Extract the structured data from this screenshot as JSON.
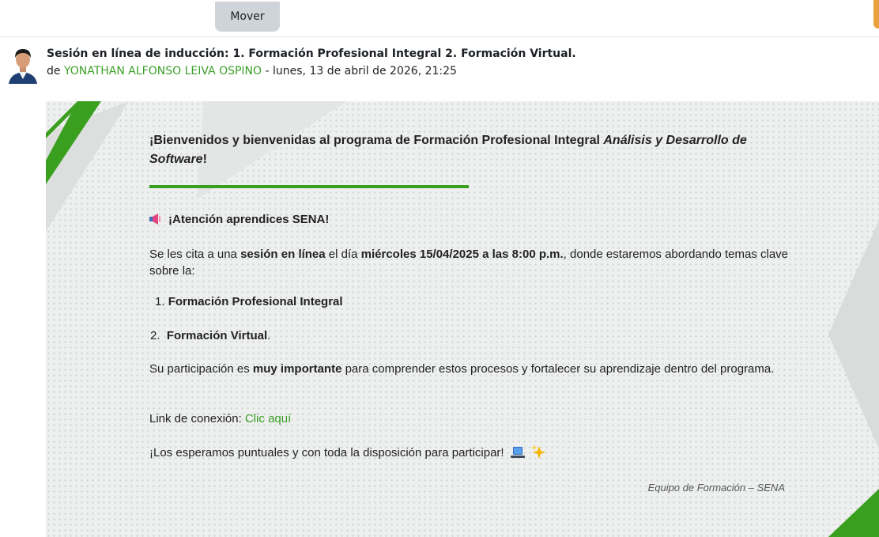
{
  "toolbar": {
    "move_label": "Mover"
  },
  "post": {
    "title": "Sesión en línea de inducción: 1. Formación Profesional Integral 2. Formación Virtual.",
    "by_prefix": "de ",
    "author": "YONATHAN ALFONSO LEIVA OSPINO",
    "date_text": " - lunes, 13 de abril de 2026, 21:25"
  },
  "message": {
    "welcome_start": "¡Bienvenidos y bienvenidas al programa de Formación Profesional Integral ",
    "welcome_program": "Análisis y Desarrollo de Software",
    "welcome_end": "!",
    "attention": "¡Atención aprendices SENA!",
    "invite_p1": "Se les cita a una ",
    "invite_b1": "sesión en línea",
    "invite_p2": " el día ",
    "invite_b2": "miércoles 15/04/2025 a las 8:00 p.m.",
    "invite_p3": ", donde estaremos abordando temas clave sobre la:",
    "item1_number": "1. ",
    "item1_text": "Formación Profesional Integral",
    "item2_number": "2.  ",
    "item2_text": "Formación Virtual",
    "item2_end": ".",
    "part_p1": "Su participación es ",
    "part_b1": "muy importante",
    "part_p2": " para comprender estos procesos y fortalecer su aprendizaje dentro del programa.",
    "link_prefix": "Link de conexión: ",
    "link_text": "Clic aquí",
    "farewell": "¡Los esperamos puntuales y con toda la disposición para participar!",
    "signature": "Equipo de Formación – SENA"
  },
  "icons": {
    "megaphone": "megaphone-icon",
    "laptop": "laptop-icon",
    "sparkles": "sparkles-icon"
  },
  "colors": {
    "accent_green": "#3a9f1e",
    "link_green": "#3b9f28",
    "button_gray": "#ced4da",
    "card_bg": "#eef0ef"
  }
}
